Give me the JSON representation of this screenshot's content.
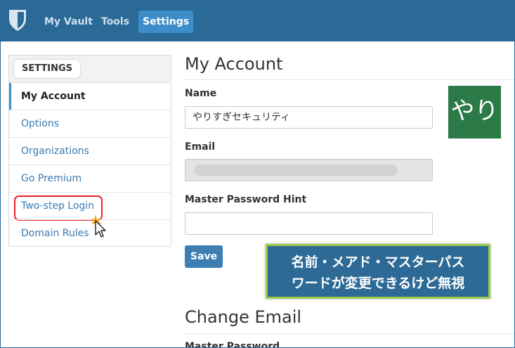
{
  "nav": {
    "items": [
      {
        "label": "My Vault"
      },
      {
        "label": "Tools"
      },
      {
        "label": "Settings"
      }
    ]
  },
  "sidebar": {
    "header": "SETTINGS",
    "items": [
      {
        "label": "My Account"
      },
      {
        "label": "Options"
      },
      {
        "label": "Organizations"
      },
      {
        "label": "Go Premium"
      },
      {
        "label": "Two-step Login"
      },
      {
        "label": "Domain Rules"
      }
    ]
  },
  "account": {
    "title": "My Account",
    "name_label": "Name",
    "name_value": "やりすぎセキュリティ",
    "email_label": "Email",
    "hint_label": "Master Password Hint",
    "hint_value": "",
    "save_label": "Save",
    "avatar_text": "やり"
  },
  "change_email": {
    "title": "Change Email",
    "master_password_label": "Master Password"
  },
  "callout": {
    "line1": "名前・メアド・マスターパス",
    "line2": "ワードが変更できるけど無視"
  },
  "colors": {
    "nav_bg": "#2b6a96",
    "nav_active": "#3c8dc9",
    "link": "#3a7ab0",
    "save_button": "#3d7fb3",
    "avatar_bg": "#2b7a47",
    "callout_bg": "#2d6b96",
    "callout_border": "#9cc94a",
    "highlight": "#e8242b"
  }
}
